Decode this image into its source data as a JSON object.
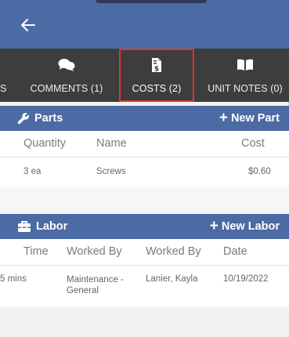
{
  "tabs": {
    "edge_fragment": "S",
    "items": [
      {
        "label": "COMMENTS (1)",
        "icon": "comments-icon"
      },
      {
        "label": "COSTS (2)",
        "icon": "receipt-dollar-icon",
        "active": true
      },
      {
        "label": "UNIT NOTES (0)",
        "icon": "book-icon"
      }
    ]
  },
  "parts": {
    "title": "Parts",
    "action": "New Part",
    "columns": {
      "quantity": "Quantity",
      "name": "Name",
      "cost": "Cost"
    },
    "rows": [
      {
        "quantity": "3 ea",
        "name": "Screws",
        "cost": "$0.60"
      }
    ]
  },
  "labor": {
    "title": "Labor",
    "action": "New Labor",
    "columns": {
      "time": "Time",
      "worked_by_1": "Worked By",
      "worked_by_2": "Worked By",
      "date": "Date"
    },
    "rows": [
      {
        "time": "5 mins",
        "worked_by_1": "Maintenance - General",
        "worked_by_2": "Lanier, Kayla",
        "date": "10/19/2022"
      }
    ]
  },
  "colors": {
    "primary": "#4c6aa4",
    "tabbar": "#3d3d3d",
    "highlight": "#e23434"
  }
}
